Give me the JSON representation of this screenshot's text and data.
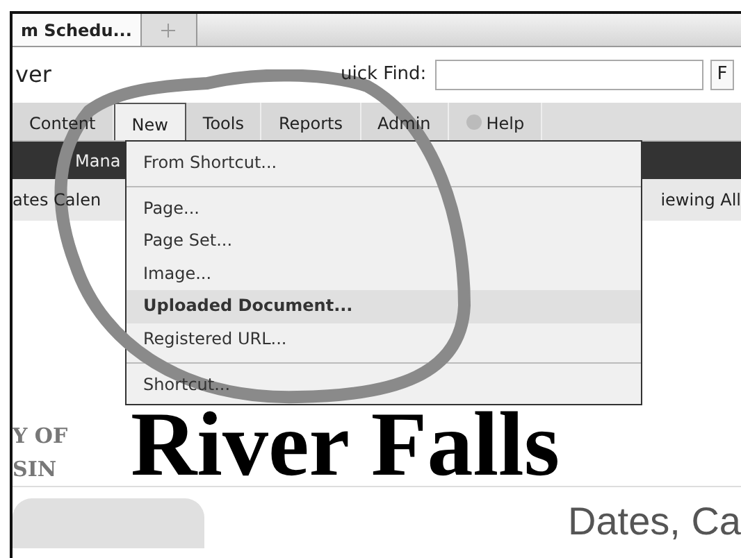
{
  "tabs": [
    {
      "label": "m Schedu...",
      "selected": true
    },
    {
      "kind": "add",
      "selected": false
    }
  ],
  "header": {
    "site": "ver",
    "quick_find_label": "uick Find:",
    "find_button": "F"
  },
  "menu_bar": [
    {
      "label": "Content",
      "selected": false
    },
    {
      "label": "New",
      "selected": true
    },
    {
      "label": "Tools",
      "selected": false
    },
    {
      "label": "Reports",
      "selected": false
    },
    {
      "label": "Admin",
      "selected": false
    },
    {
      "label": "Help",
      "selected": false,
      "kind": "help"
    }
  ],
  "toolbar": {
    "item": "Mana"
  },
  "breadcrumb": {
    "left": "ates Calen",
    "right": "iewing All"
  },
  "dropdown": [
    {
      "label": "From Shortcut...",
      "kind": "item",
      "highlighted": false
    },
    {
      "kind": "separator"
    },
    {
      "label": "Page...",
      "kind": "item",
      "highlighted": false
    },
    {
      "label": "Page Set...",
      "kind": "item",
      "highlighted": false
    },
    {
      "label": "Image...",
      "kind": "item",
      "highlighted": false
    },
    {
      "label": "Uploaded Document...",
      "kind": "item",
      "highlighted": true
    },
    {
      "label": "Registered URL...",
      "kind": "item",
      "highlighted": false
    },
    {
      "kind": "separator"
    },
    {
      "label": "Shortcut...",
      "kind": "item",
      "highlighted": false
    }
  ],
  "banner": {
    "small_lines": [
      "Y OF",
      "SIN"
    ],
    "title": "River Falls"
  },
  "content": {
    "heading": "Dates, Ca"
  }
}
